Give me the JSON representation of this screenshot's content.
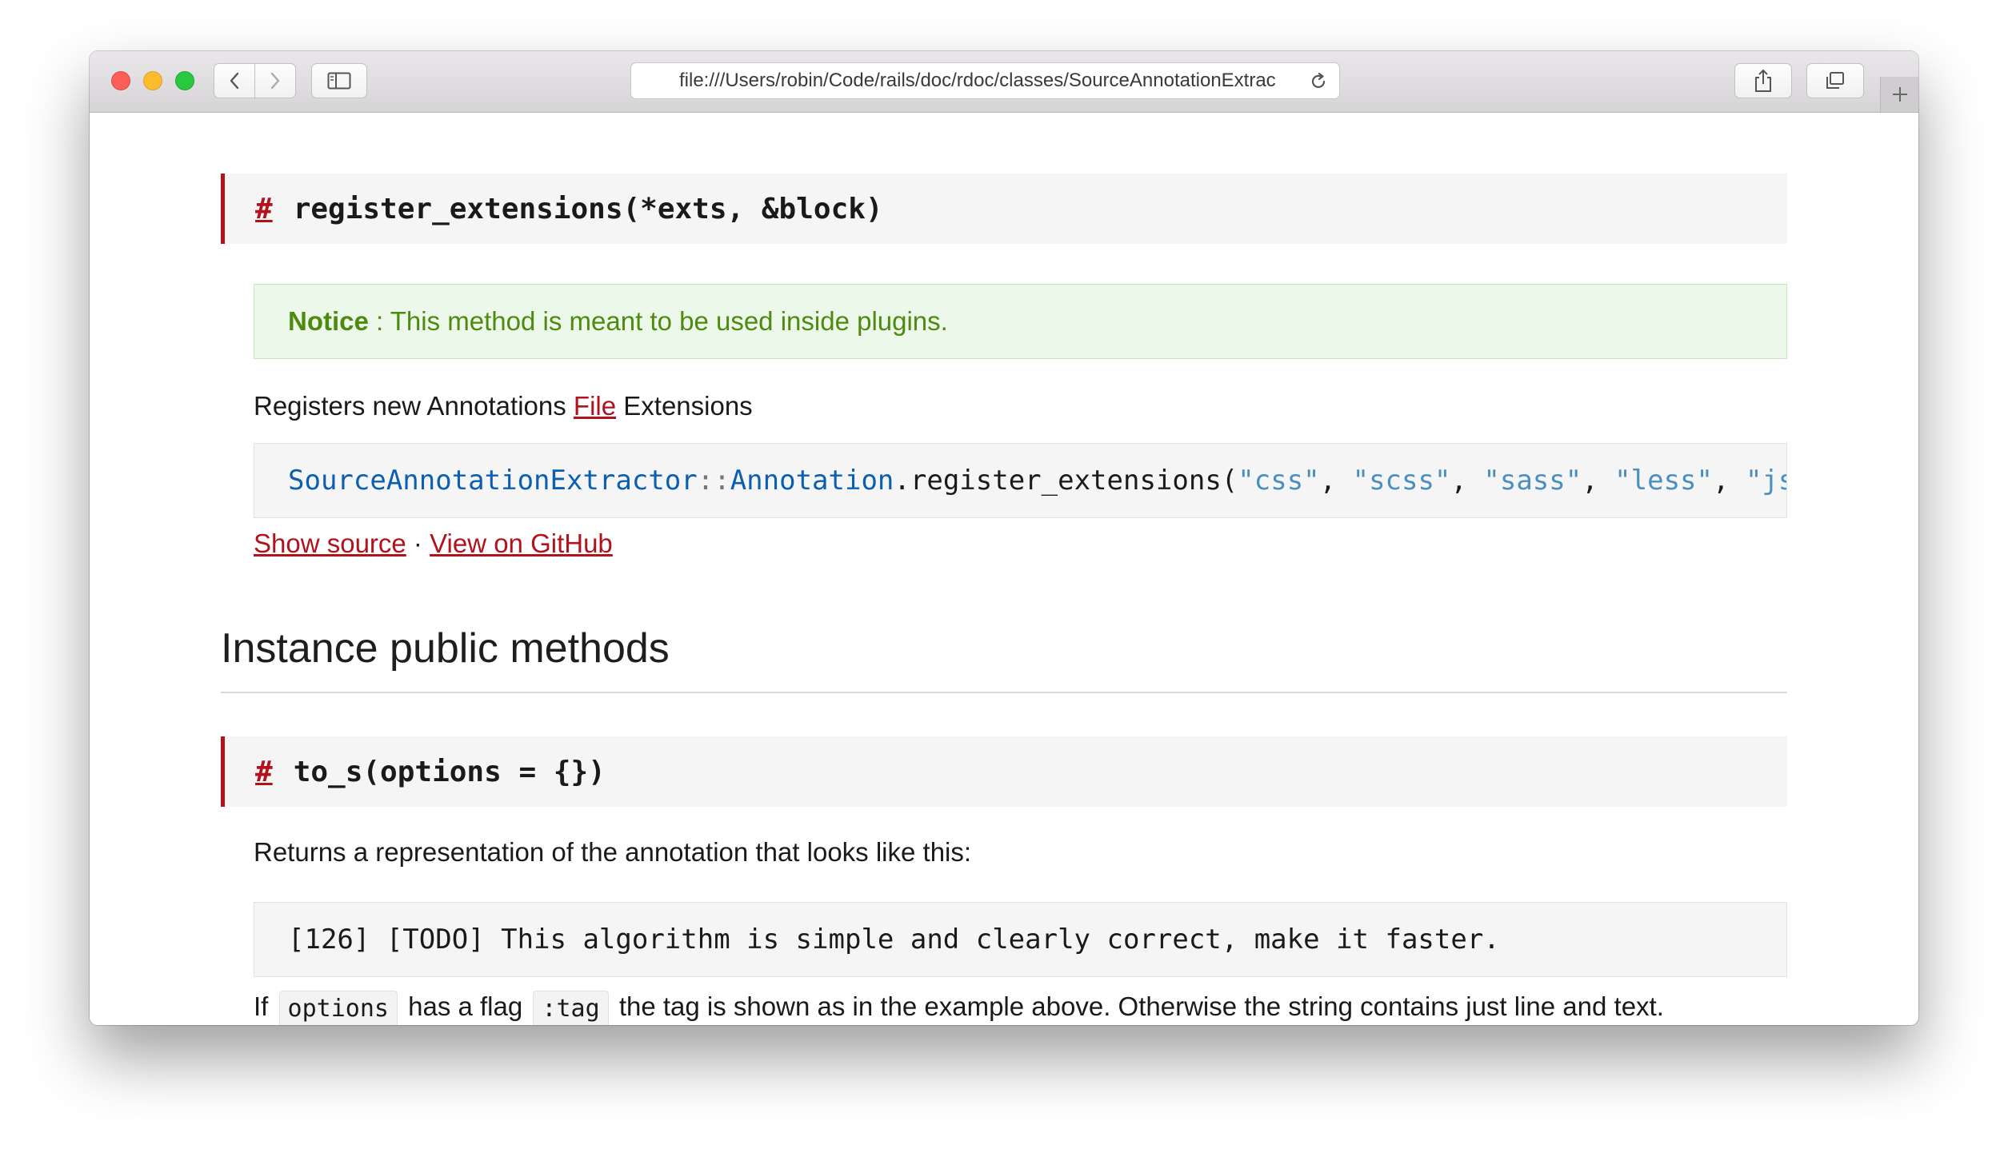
{
  "browser": {
    "url": "file:///Users/robin/Code/rails/doc/rdoc/classes/SourceAnnotationExtrac"
  },
  "method1": {
    "anchor": "#",
    "signature": "register_extensions(*exts, &block)",
    "notice_label": "Notice",
    "notice_text": " : This method is meant to be used inside plugins.",
    "desc_before": "Registers new Annotations ",
    "desc_link": "File",
    "desc_after": " Extensions",
    "code": {
      "const1": "SourceAnnotationExtractor",
      "sep": "::",
      "const2": "Annotation",
      "call": ".register_extensions(",
      "s1": "\"css\"",
      "s2": "\"scss\"",
      "s3": "\"sass\"",
      "s4": "\"less\"",
      "s5": "\"js",
      "comma": ", "
    },
    "show_source": "Show source",
    "dot": " · ",
    "view_github": "View on GitHub"
  },
  "section": {
    "title": "Instance public methods"
  },
  "method2": {
    "anchor": "#",
    "signature": "to_s(options = {})",
    "desc": "Returns a representation of the annotation that looks like this:",
    "code": "[126] [TODO] This algorithm is simple and clearly correct, make it faster.",
    "p_if": "If ",
    "p_code1": "options",
    "p_mid": " has a flag ",
    "p_code2": ":tag",
    "p_end": " the tag is shown as in the example above. Otherwise the string contains just line and text."
  }
}
